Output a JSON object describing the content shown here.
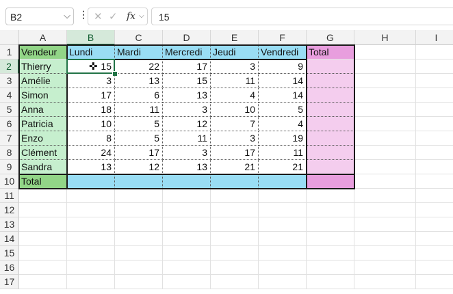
{
  "formula_bar": {
    "name_box": "B2",
    "cancel_icon": "✕",
    "enter_icon": "✓",
    "fx_label": "fx",
    "formula_value": "15"
  },
  "columns": [
    "A",
    "B",
    "C",
    "D",
    "E",
    "F",
    "G",
    "H",
    "I"
  ],
  "rows": [
    "1",
    "2",
    "3",
    "4",
    "5",
    "6",
    "7",
    "8",
    "9",
    "10",
    "11",
    "12",
    "13",
    "14",
    "15",
    "16",
    "17"
  ],
  "header_row": [
    "Vendeur",
    "Lundi",
    "Mardi",
    "Mercredi",
    "Jeudi",
    "Vendredi",
    "Total"
  ],
  "data_rows": [
    {
      "name": "Thierry",
      "values": [
        15,
        22,
        17,
        3,
        9
      ]
    },
    {
      "name": "Amélie",
      "values": [
        3,
        13,
        15,
        11,
        14
      ]
    },
    {
      "name": "Simon",
      "values": [
        17,
        6,
        13,
        4,
        14
      ]
    },
    {
      "name": "Anna",
      "values": [
        18,
        11,
        3,
        10,
        5
      ]
    },
    {
      "name": "Patricia",
      "values": [
        10,
        5,
        12,
        7,
        4
      ]
    },
    {
      "name": "Enzo",
      "values": [
        8,
        5,
        11,
        3,
        19
      ]
    },
    {
      "name": "Clément",
      "values": [
        24,
        17,
        3,
        17,
        11
      ]
    },
    {
      "name": "Sandra",
      "values": [
        13,
        12,
        13,
        21,
        21
      ]
    }
  ],
  "total_row_label": "Total",
  "selected_cell": "B2",
  "colors": {
    "name_fill": "#c6efce",
    "name_header_fill": "#92d587",
    "day_header_fill": "#99ddf4",
    "total_col_fill": "#f4cdee",
    "total_header_fill": "#e89ede",
    "total_row_fill": "#99ddf4",
    "total_row_label_fill": "#92d587",
    "selection": "#217346"
  }
}
